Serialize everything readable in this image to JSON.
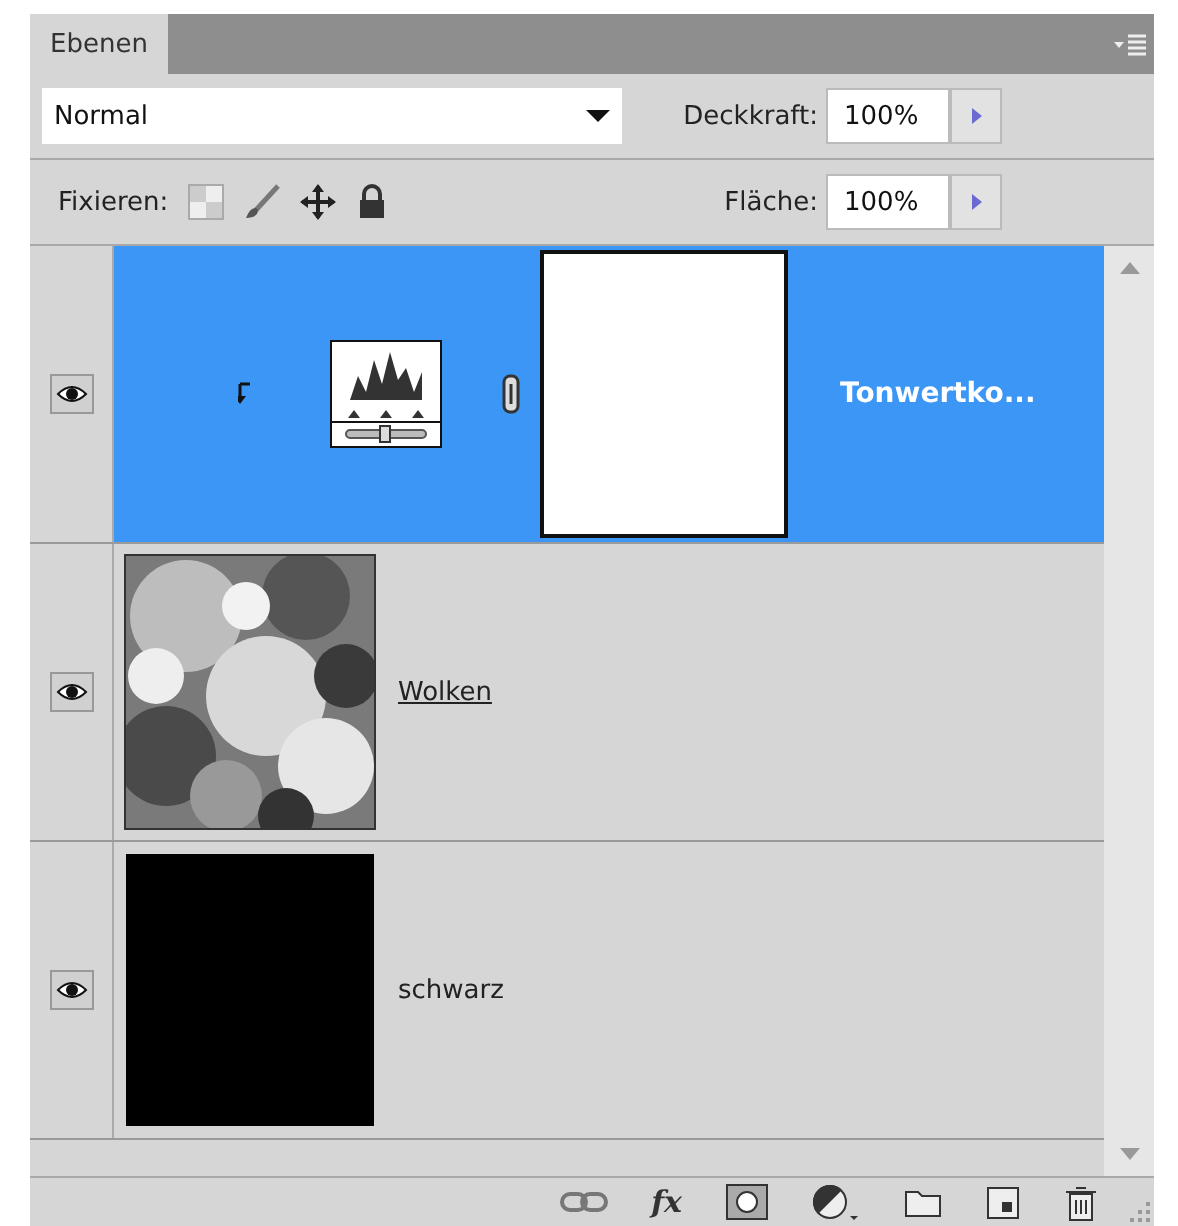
{
  "panel": {
    "tab": "Ebenen"
  },
  "blend_mode": {
    "value": "Normal"
  },
  "opacity": {
    "label": "Deckkraft:",
    "value": "100%"
  },
  "lock": {
    "label": "Fixieren:"
  },
  "fill": {
    "label": "Fläche:",
    "value": "100%"
  },
  "footer": {
    "style_button": "fx"
  },
  "layers": [
    {
      "kind": "adjustment",
      "name": "Tonwertko...",
      "visible": true,
      "selected": true,
      "underlined": false
    },
    {
      "kind": "clouds",
      "name": "Wolken",
      "visible": true,
      "selected": false,
      "underlined": true
    },
    {
      "kind": "solid",
      "name": "schwarz",
      "visible": true,
      "selected": false,
      "underlined": false
    }
  ]
}
